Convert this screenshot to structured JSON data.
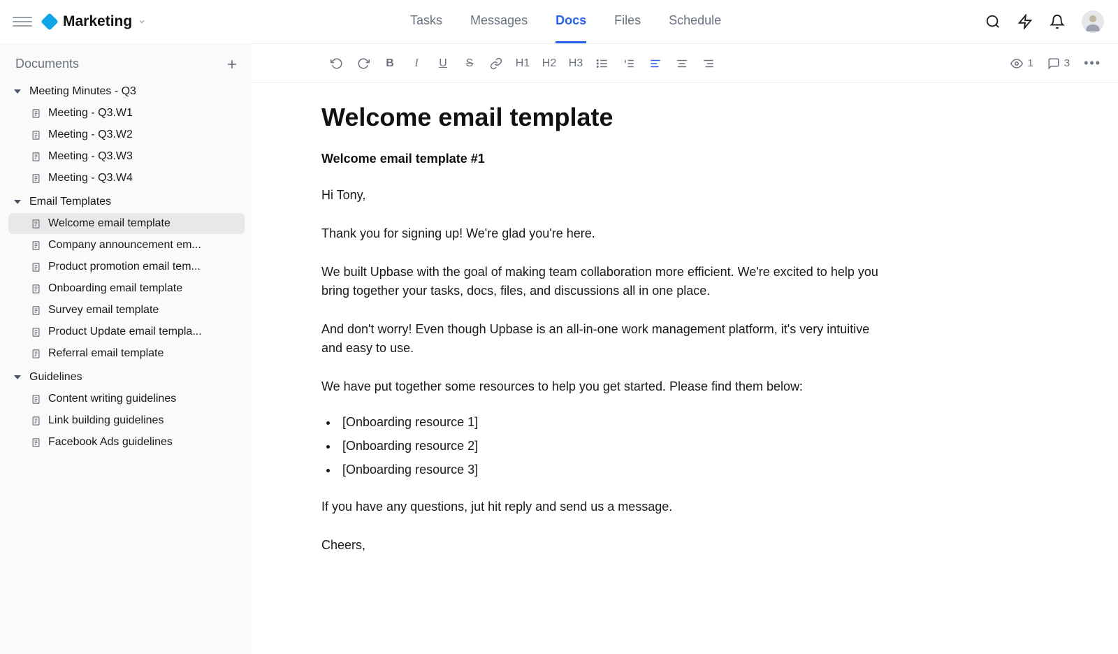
{
  "header": {
    "workspace": "Marketing",
    "tabs": [
      "Tasks",
      "Messages",
      "Docs",
      "Files",
      "Schedule"
    ],
    "activeTab": "Docs"
  },
  "sidebar": {
    "title": "Documents",
    "folders": [
      {
        "name": "Meeting Minutes - Q3",
        "expanded": true,
        "docs": [
          {
            "name": "Meeting - Q3.W1",
            "active": false
          },
          {
            "name": "Meeting - Q3.W2",
            "active": false
          },
          {
            "name": "Meeting - Q3.W3",
            "active": false
          },
          {
            "name": "Meeting - Q3.W4",
            "active": false
          }
        ]
      },
      {
        "name": "Email Templates",
        "expanded": true,
        "docs": [
          {
            "name": "Welcome email template",
            "active": true
          },
          {
            "name": "Company announcement em...",
            "active": false
          },
          {
            "name": "Product promotion email tem...",
            "active": false
          },
          {
            "name": "Onboarding email template",
            "active": false
          },
          {
            "name": "Survey email template",
            "active": false
          },
          {
            "name": "Product Update email templa...",
            "active": false
          },
          {
            "name": "Referral email template",
            "active": false
          }
        ]
      },
      {
        "name": "Guidelines",
        "expanded": true,
        "docs": [
          {
            "name": "Content writing guidelines",
            "active": false
          },
          {
            "name": "Link building guidelines",
            "active": false
          },
          {
            "name": "Facebook Ads guidelines",
            "active": false
          }
        ]
      }
    ]
  },
  "toolbar": {
    "h1": "H1",
    "h2": "H2",
    "h3": "H3",
    "views": "1",
    "comments": "3"
  },
  "document": {
    "title": "Welcome email template",
    "subtitle": "Welcome email template #1",
    "p1": "Hi Tony,",
    "p2": "Thank you for signing up! We're glad you're here.",
    "p3": "We built Upbase with the goal of making team collaboration more efficient. We're excited to help you bring together your tasks, docs, files, and discussions all in one place.",
    "p4": "And don't worry! Even though Upbase is an all-in-one work management platform, it's very intuitive and easy to use.",
    "p5": "We have put together some resources to help you get started. Please find them below:",
    "list": [
      "[Onboarding resource 1]",
      "[Onboarding resource 2]",
      "[Onboarding resource 3]"
    ],
    "p6": "If you have any questions, jut hit reply and send us a message.",
    "p7": "Cheers,"
  }
}
